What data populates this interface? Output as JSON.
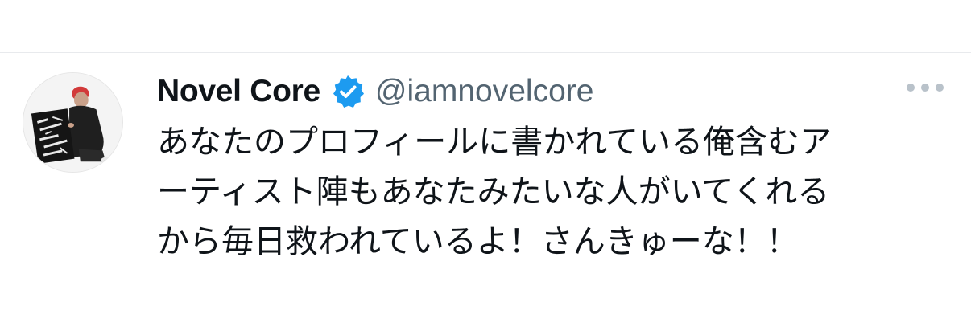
{
  "tweet": {
    "display_name": "Novel Core",
    "handle": "@iamnovelcore",
    "verified": true,
    "body_lines": [
      "あなたのプロフィールに書かれている俺含むア",
      "ーティスト陣もあなたみたいな人がいてくれる",
      "から毎日救われているよ！さんきゅーな！！"
    ]
  },
  "icons": {
    "avatar": "avatar",
    "verified": "verified-badge-icon",
    "more": "more-options-icon"
  },
  "colors": {
    "verified_badge": "#1d9bf0",
    "name": "#0f1419",
    "handle": "#536471",
    "more_dots": "#b9c2ca"
  }
}
